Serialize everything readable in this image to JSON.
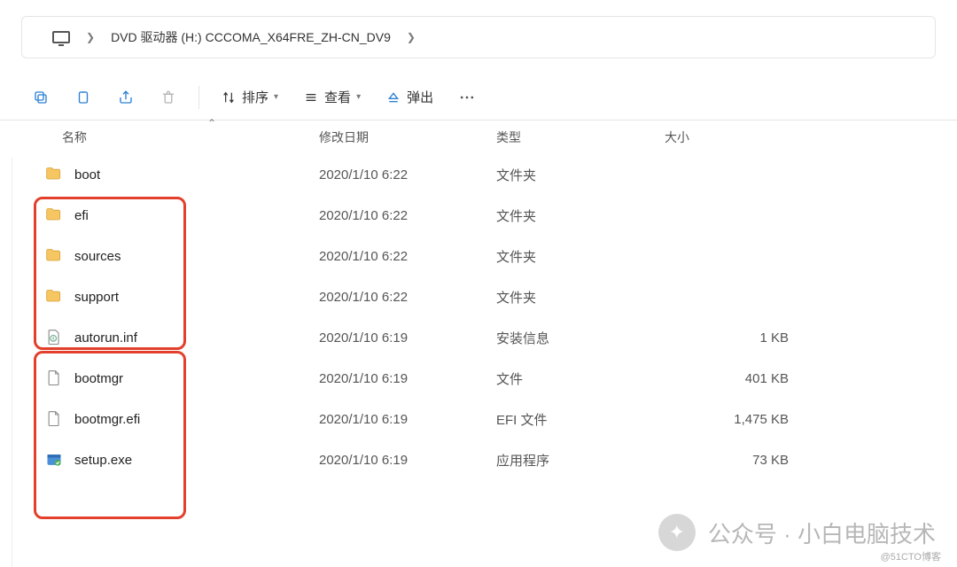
{
  "breadcrumb": {
    "drive_label": "DVD 驱动器 (H:) CCCOMA_X64FRE_ZH-CN_DV9"
  },
  "toolbar": {
    "sort_label": "排序",
    "view_label": "查看",
    "eject_label": "弹出"
  },
  "columns": {
    "name": "名称",
    "date": "修改日期",
    "type": "类型",
    "size": "大小"
  },
  "files": [
    {
      "name": "boot",
      "date": "2020/1/10 6:22",
      "type": "文件夹",
      "size": "",
      "icon": "folder"
    },
    {
      "name": "efi",
      "date": "2020/1/10 6:22",
      "type": "文件夹",
      "size": "",
      "icon": "folder"
    },
    {
      "name": "sources",
      "date": "2020/1/10 6:22",
      "type": "文件夹",
      "size": "",
      "icon": "folder"
    },
    {
      "name": "support",
      "date": "2020/1/10 6:22",
      "type": "文件夹",
      "size": "",
      "icon": "folder"
    },
    {
      "name": "autorun.inf",
      "date": "2020/1/10 6:19",
      "type": "安装信息",
      "size": "1 KB",
      "icon": "inf"
    },
    {
      "name": "bootmgr",
      "date": "2020/1/10 6:19",
      "type": "文件",
      "size": "401 KB",
      "icon": "file"
    },
    {
      "name": "bootmgr.efi",
      "date": "2020/1/10 6:19",
      "type": "EFI 文件",
      "size": "1,475 KB",
      "icon": "file"
    },
    {
      "name": "setup.exe",
      "date": "2020/1/10 6:19",
      "type": "应用程序",
      "size": "73 KB",
      "icon": "exe"
    }
  ],
  "watermark": {
    "text": "公众号 · 小白电脑技术",
    "footer": "@51CTO博客"
  }
}
